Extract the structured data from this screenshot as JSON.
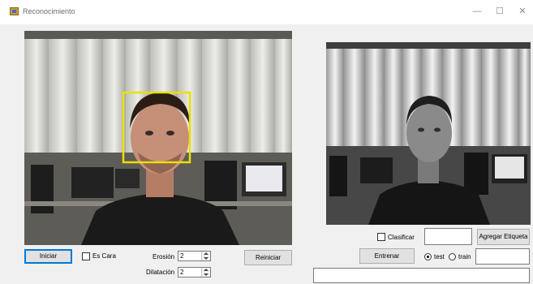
{
  "window": {
    "title": "Reconocimiento",
    "minimize_glyph": "—",
    "maximize_glyph": "☐",
    "close_glyph": "✕"
  },
  "colors": {
    "face_box": "#e8e000",
    "accent": "#0078d7"
  },
  "controls": {
    "iniciar_label": "Iniciar",
    "es_cara_label": "Es Cara",
    "es_cara_checked": false,
    "erosion_label": "Erosión",
    "erosion_value": "2",
    "dilatacion_label": "Dilatación",
    "dilatacion_value": "2",
    "reiniciar_label": "Reiniciar",
    "clasificar_label": "Clasificar",
    "clasificar_checked": false,
    "clasificar_text": "",
    "agregar_etiqueta_label": "Agregar Etiqueta",
    "entrenar_label": "Entrenar",
    "radio_test_label": "test",
    "radio_train_label": "train",
    "selected_mode": "test",
    "train_text": "",
    "bottom_text": ""
  },
  "icons": {
    "app": "app-form-icon",
    "spinner": "spin-arrows-icon"
  }
}
